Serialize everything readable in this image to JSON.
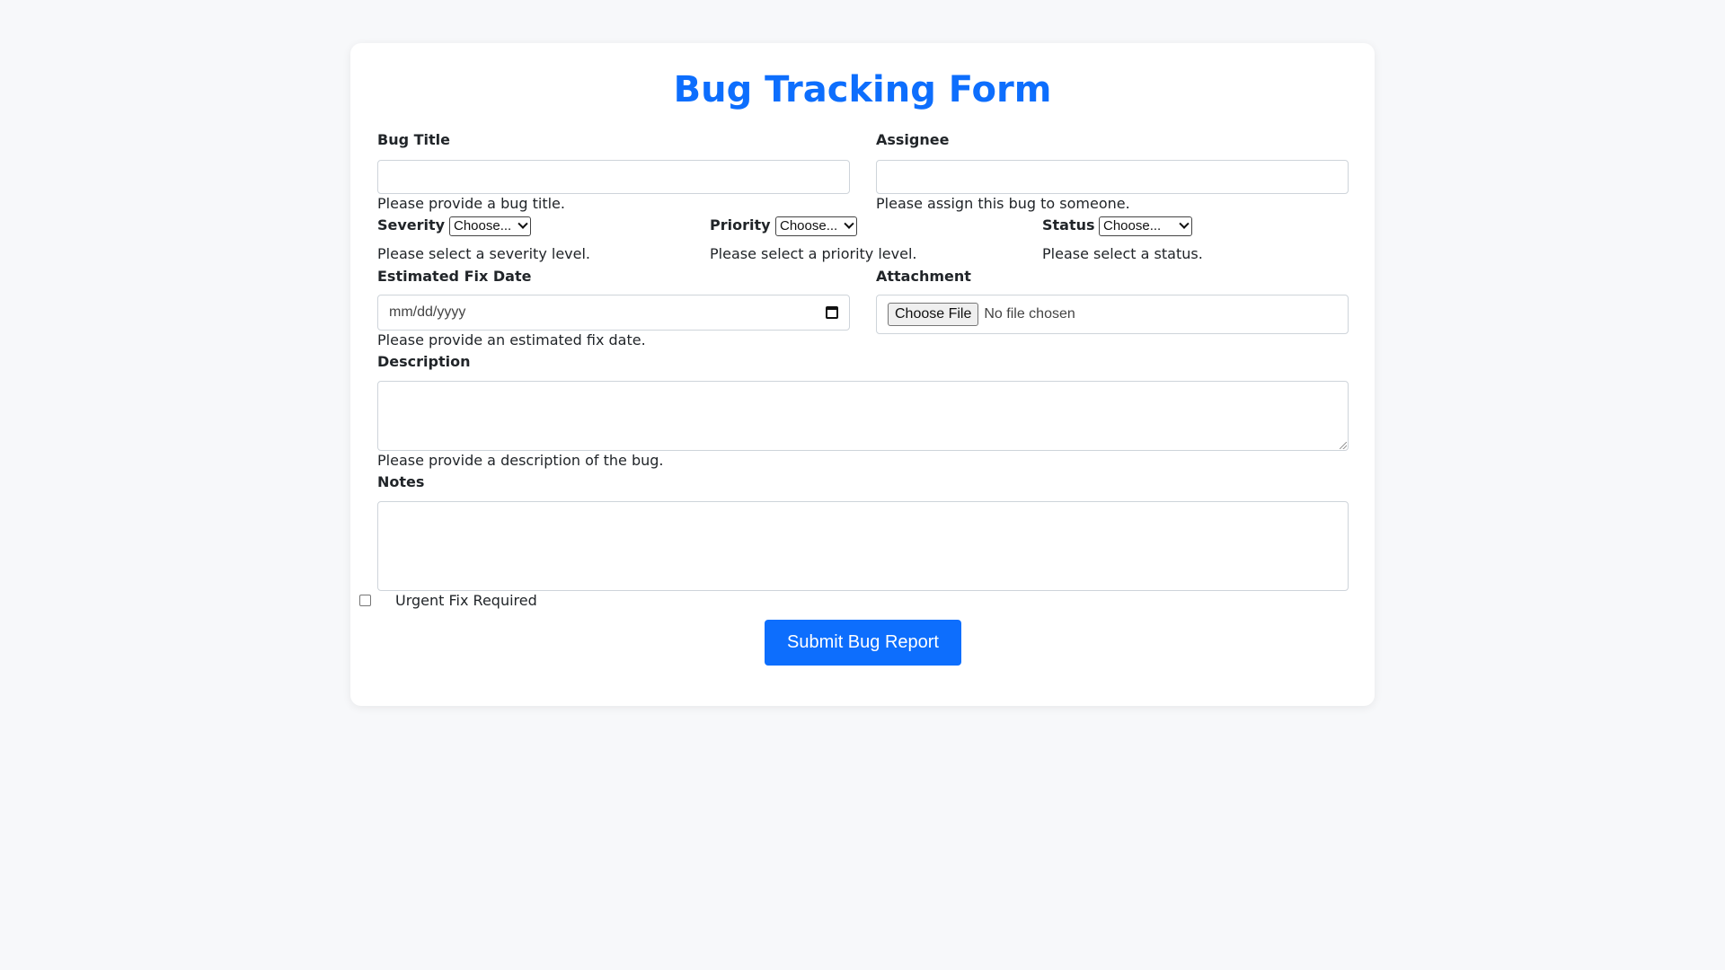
{
  "form": {
    "title": "Bug Tracking Form",
    "bug_title": {
      "label": "Bug Title",
      "value": "",
      "help": "Please provide a bug title."
    },
    "assignee": {
      "label": "Assignee",
      "value": "",
      "help": "Please assign this bug to someone."
    },
    "severity": {
      "label": "Severity",
      "selected": "Choose...",
      "help": "Please select a severity level."
    },
    "priority": {
      "label": "Priority",
      "selected": "Choose...",
      "help": "Please select a priority level."
    },
    "status": {
      "label": "Status",
      "selected": "Choose...",
      "help": "Please select a status."
    },
    "fix_date": {
      "label": "Estimated Fix Date",
      "placeholder": "mm/dd/yyyy",
      "help": "Please provide an estimated fix date."
    },
    "attachment": {
      "label": "Attachment",
      "button_label": "Choose File",
      "status_text": "No file chosen"
    },
    "description": {
      "label": "Description",
      "value": "",
      "help": "Please provide a description of the bug."
    },
    "notes": {
      "label": "Notes",
      "value": ""
    },
    "urgent": {
      "label": "Urgent Fix Required",
      "checked": false
    },
    "submit_label": "Submit Bug Report"
  },
  "colors": {
    "accent": "#0d6efd",
    "page_background": "#f7f8fa",
    "card_background": "#ffffff",
    "input_border": "#ced4da"
  },
  "icons": {
    "select_arrow": "chevron-down-icon",
    "date_picker": "calendar-icon"
  }
}
